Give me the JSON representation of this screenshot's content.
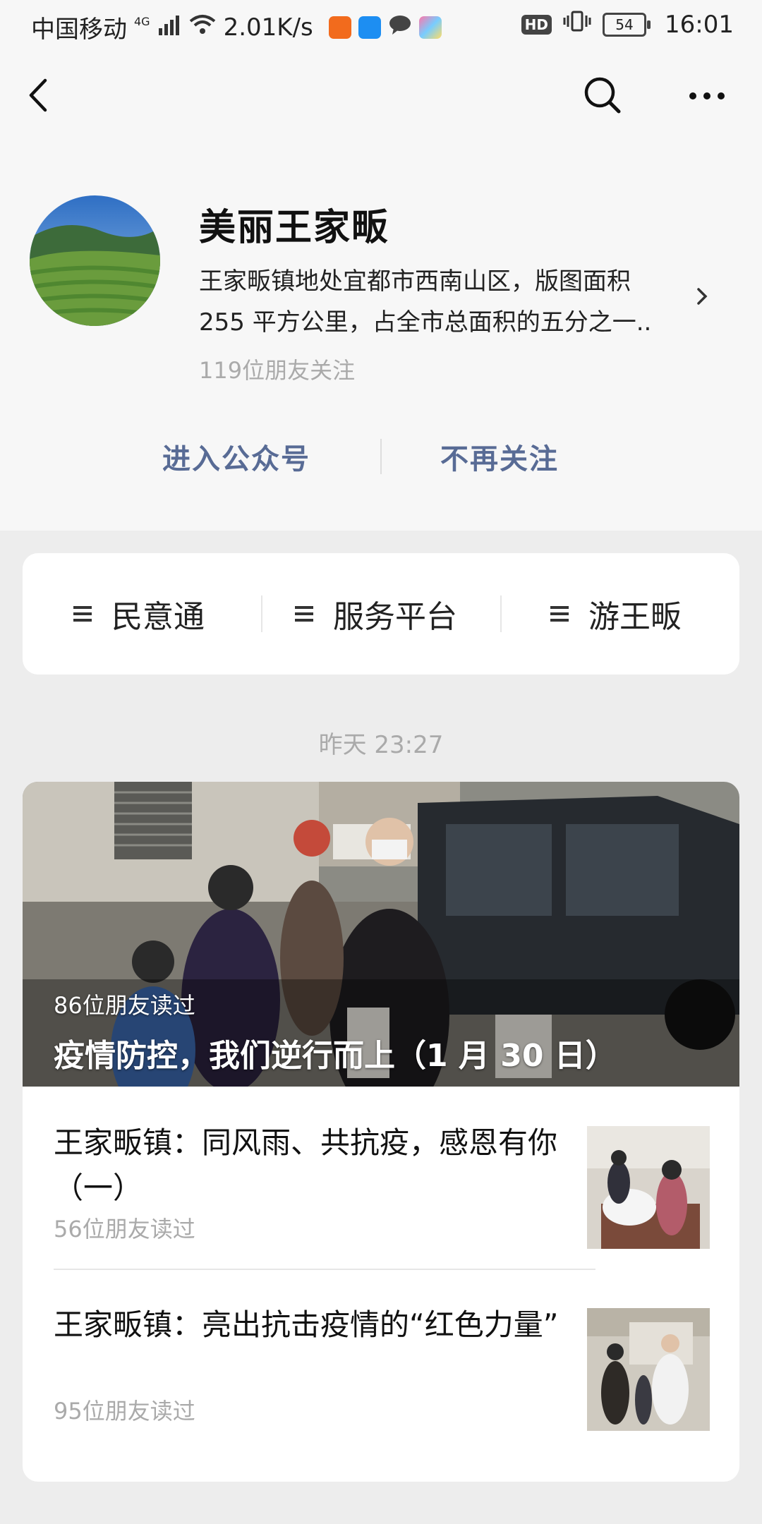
{
  "status_bar": {
    "carrier": "中国移动",
    "network": "4G",
    "speed": "2.01K/s",
    "hd": "HD",
    "battery": "54",
    "time": "16:01"
  },
  "nav": {
    "back_icon": "back-arrow-icon",
    "search_icon": "search-icon",
    "more_icon": "more-icon"
  },
  "profile": {
    "name": "美丽王家畈",
    "description_line1": "王家畈镇地处宜都市西南山区，版图面积",
    "description_line2": "255 平方公里，占全市总面积的五分之一..",
    "followers": "119位朋友关注",
    "enter_label": "进入公众号",
    "unfollow_label": "不再关注"
  },
  "menu": {
    "items": [
      {
        "label": "民意通"
      },
      {
        "label": "服务平台"
      },
      {
        "label": "游王畈"
      }
    ]
  },
  "feed": {
    "time": "昨天 23:27",
    "cover": {
      "readers": "86位朋友读过",
      "title": "疫情防控，我们逆行而上（1 月 30 日）"
    },
    "items": [
      {
        "title": "王家畈镇：同风雨、共抗疫，感恩有你（一）",
        "readers": "56位朋友读过"
      },
      {
        "title": "王家畈镇：亮出抗击疫情的“红色力量”",
        "readers": "95位朋友读过"
      }
    ]
  },
  "colors": {
    "accent_link": "#586b95",
    "background": "#ededed",
    "header_bg": "#f7f7f7"
  }
}
